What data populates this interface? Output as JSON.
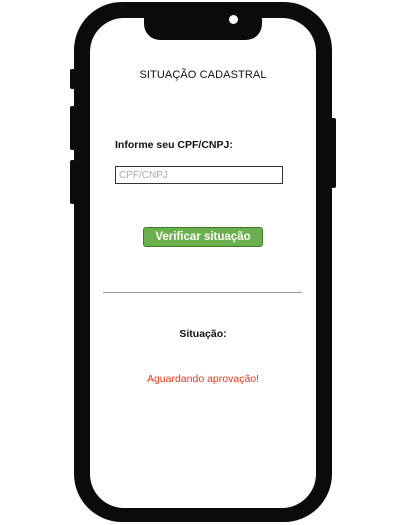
{
  "header": {
    "title": "SITUAÇÃO CADASTRAL"
  },
  "form": {
    "label": "Informe seu CPF/CNPJ:",
    "input_value": "",
    "input_placeholder": "CPF/CNPJ",
    "button_label": "Verificar situação"
  },
  "result": {
    "label": "Situação:",
    "value": "Aguardando aprovação!"
  },
  "colors": {
    "button_bg": "#6ab04c",
    "status_text": "#e03a1e",
    "phone_frame": "#0b0b0b"
  }
}
